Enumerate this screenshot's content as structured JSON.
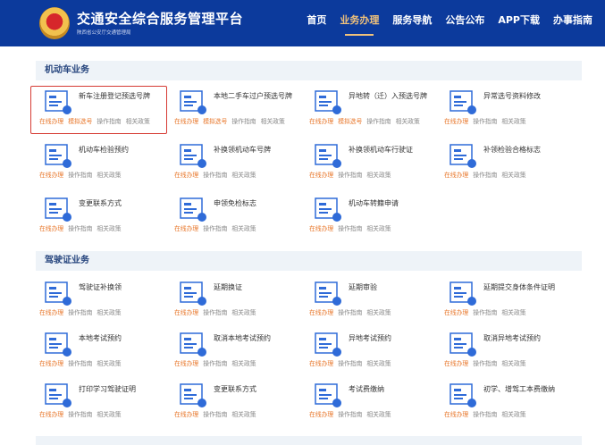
{
  "header": {
    "title": "交通安全综合服务管理平台",
    "subtitle": "陕西省公安厅交通管理局",
    "nav": [
      {
        "label": "首页",
        "active": false
      },
      {
        "label": "业务办理",
        "active": true
      },
      {
        "label": "服务导航",
        "active": false
      },
      {
        "label": "公告公布",
        "active": false
      },
      {
        "label": "APP下载",
        "active": false
      },
      {
        "label": "办事指南",
        "active": false
      }
    ]
  },
  "colors": {
    "header": "#0c3a9c",
    "accent": "#e8772b",
    "icon": "#2f6bd8"
  },
  "sections": [
    {
      "title": "机动车业务",
      "items": [
        {
          "title": "新车注册登记预选号牌",
          "links": [
            "在线办理",
            "模拟选号",
            "操作指南",
            "相关政策"
          ],
          "icon": "new-plate-icon",
          "highlighted": true
        },
        {
          "title": "本地二手车过户预选号牌",
          "links": [
            "在线办理",
            "模拟选号",
            "操作指南",
            "相关政策"
          ],
          "icon": "car-transfer-icon"
        },
        {
          "title": "异地转（迁）入预选号牌",
          "links": [
            "在线办理",
            "模拟选号",
            "操作指南",
            "相关政策"
          ],
          "icon": "car-import-icon"
        },
        {
          "title": "异常选号资料修改",
          "links": [
            "在线办理",
            "操作指南",
            "相关政策"
          ],
          "icon": "number-edit-icon"
        },
        {
          "title": "机动车检验预约",
          "links": [
            "在线办理",
            "操作指南",
            "相关政策"
          ],
          "icon": "inspection-booking-icon"
        },
        {
          "title": "补换领机动车号牌",
          "links": [
            "在线办理",
            "操作指南",
            "相关政策"
          ],
          "icon": "plate-replace-icon"
        },
        {
          "title": "补换领机动车行驶证",
          "links": [
            "在线办理",
            "操作指南",
            "相关政策"
          ],
          "icon": "license-replace-icon"
        },
        {
          "title": "补领检验合格标志",
          "links": [
            "在线办理",
            "操作指南",
            "相关政策"
          ],
          "icon": "inspection-sign-icon"
        },
        {
          "title": "变更联系方式",
          "links": [
            "在线办理",
            "操作指南",
            "相关政策"
          ],
          "icon": "contact-change-icon"
        },
        {
          "title": "申领免检标志",
          "links": [
            "在线办理",
            "操作指南",
            "相关政策"
          ],
          "icon": "exempt-sign-icon"
        },
        {
          "title": "机动车转籍申请",
          "links": [
            "在线办理",
            "操作指南",
            "相关政策"
          ],
          "icon": "car-relocate-icon"
        }
      ]
    },
    {
      "title": "驾驶证业务",
      "items": [
        {
          "title": "驾驶证补换领",
          "links": [
            "在线办理",
            "操作指南",
            "相关政策"
          ],
          "icon": "driver-license-icon"
        },
        {
          "title": "延期换证",
          "links": [
            "在线办理",
            "操作指南",
            "相关政策"
          ],
          "icon": "extend-renew-icon"
        },
        {
          "title": "延期审验",
          "links": [
            "在线办理",
            "操作指南",
            "相关政策"
          ],
          "icon": "extend-review-icon"
        },
        {
          "title": "延期提交身体条件证明",
          "links": [
            "在线办理",
            "操作指南",
            "相关政策"
          ],
          "icon": "health-cert-icon"
        },
        {
          "title": "本地考试预约",
          "links": [
            "在线办理",
            "操作指南",
            "相关政策"
          ],
          "icon": "exam-booking-icon"
        },
        {
          "title": "取消本地考试预约",
          "links": [
            "在线办理",
            "操作指南",
            "相关政策"
          ],
          "icon": "calendar-cancel-icon"
        },
        {
          "title": "异地考试预约",
          "links": [
            "在线办理",
            "操作指南",
            "相关政策"
          ],
          "icon": "remote-exam-icon"
        },
        {
          "title": "取消异地考试预约",
          "links": [
            "在线办理",
            "操作指南",
            "相关政策"
          ],
          "icon": "calendar-cancel-icon"
        },
        {
          "title": "打印学习驾驶证明",
          "links": [
            "在线办理",
            "操作指南",
            "相关政策"
          ],
          "icon": "print-cert-icon"
        },
        {
          "title": "变更联系方式",
          "links": [
            "在线办理",
            "操作指南",
            "相关政策"
          ],
          "icon": "contact-change-icon"
        },
        {
          "title": "考试费缴纳",
          "links": [
            "在线办理",
            "操作指南",
            "相关政策"
          ],
          "icon": "exam-fee-icon"
        },
        {
          "title": "初学、增驾工本费缴纳",
          "links": [
            "在线办理",
            "操作指南",
            "相关政策"
          ],
          "icon": "fee-icon"
        }
      ]
    }
  ]
}
